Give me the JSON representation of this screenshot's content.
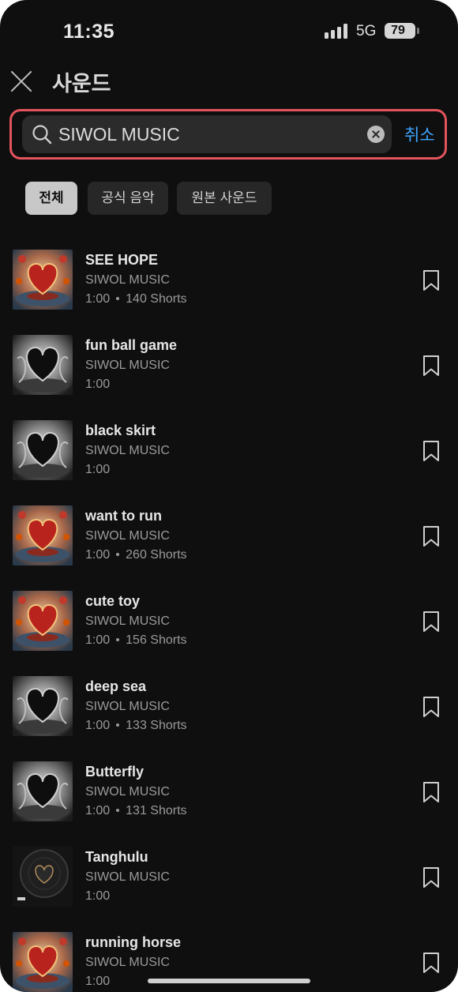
{
  "status_bar": {
    "time": "11:35",
    "network": "5G",
    "battery": "79"
  },
  "header": {
    "title": "사운드",
    "close_icon": "close-icon"
  },
  "search": {
    "value": "SIWOL MUSIC",
    "cancel_label": "취소"
  },
  "chips": [
    {
      "label": "전체",
      "selected": true
    },
    {
      "label": "공식 음악",
      "selected": false
    },
    {
      "label": "원본 사운드",
      "selected": false
    }
  ],
  "sounds": [
    {
      "title": "SEE HOPE",
      "artist": "SIWOL MUSIC",
      "duration": "1:00",
      "shorts": "140 Shorts",
      "art": "red-heart"
    },
    {
      "title": "fun ball game",
      "artist": "SIWOL MUSIC",
      "duration": "1:00",
      "shorts": "",
      "art": "dark-heart"
    },
    {
      "title": "black skirt",
      "artist": "SIWOL MUSIC",
      "duration": "1:00",
      "shorts": "",
      "art": "dark-heart"
    },
    {
      "title": "want to run",
      "artist": "SIWOL MUSIC",
      "duration": "1:00",
      "shorts": "260 Shorts",
      "art": "red-heart"
    },
    {
      "title": "cute toy",
      "artist": "SIWOL MUSIC",
      "duration": "1:00",
      "shorts": "156 Shorts",
      "art": "red-heart"
    },
    {
      "title": "deep sea",
      "artist": "SIWOL MUSIC",
      "duration": "1:00",
      "shorts": "133 Shorts",
      "art": "dark-heart"
    },
    {
      "title": "Butterfly",
      "artist": "SIWOL MUSIC",
      "duration": "1:00",
      "shorts": "131 Shorts",
      "art": "dark-heart"
    },
    {
      "title": "Tanghulu",
      "artist": "SIWOL MUSIC",
      "duration": "1:00",
      "shorts": "",
      "art": "vinyl-heart"
    },
    {
      "title": "running horse",
      "artist": "SIWOL MUSIC",
      "duration": "1:00",
      "shorts": "",
      "art": "red-heart"
    }
  ],
  "colors": {
    "accent": "#3ea6ff",
    "highlight": "#e3545d",
    "background": "#0f0f0f"
  }
}
